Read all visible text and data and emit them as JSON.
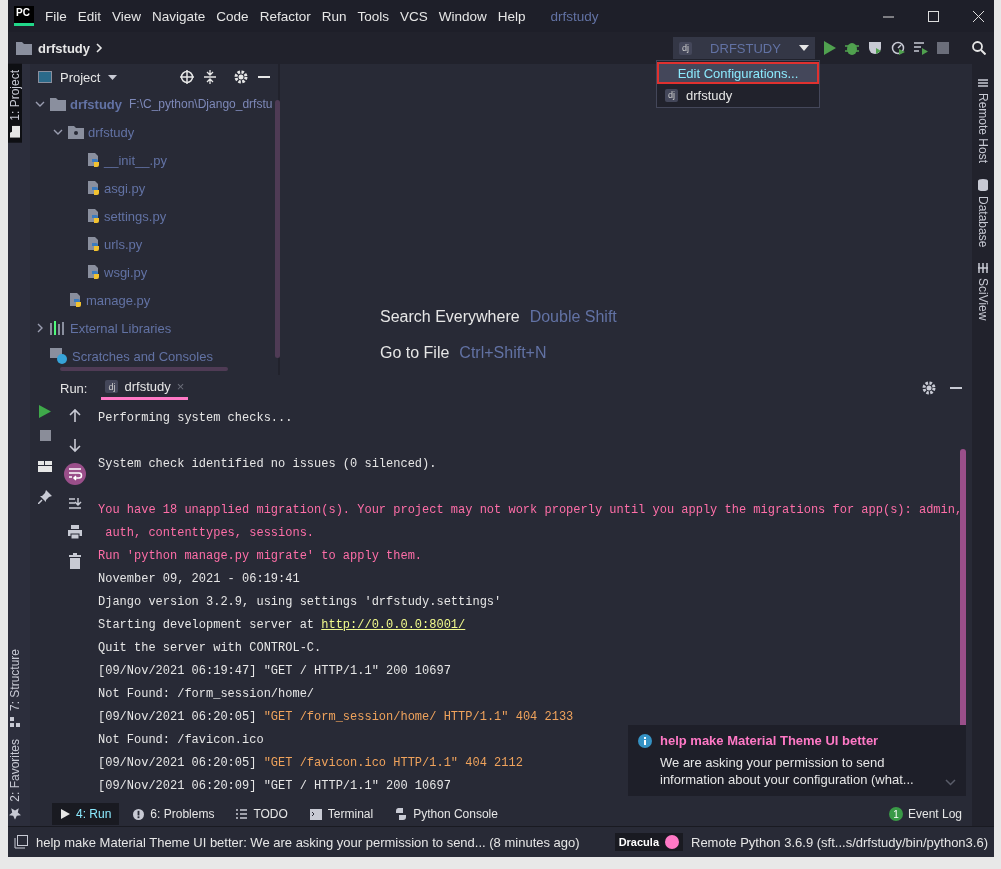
{
  "window": {
    "logo": "PC",
    "menu": [
      "File",
      "Edit",
      "View",
      "Navigate",
      "Code",
      "Refactor",
      "Run",
      "Tools",
      "VCS",
      "Window",
      "Help"
    ],
    "title": "drfstudy"
  },
  "navbar": {
    "breadcrumb": "drfstudy",
    "run_config": {
      "badge": "dj",
      "label": "DRFSTUDY"
    },
    "dropdown": [
      {
        "kind": "action",
        "label": "Edit Configurations...",
        "selected": true
      },
      {
        "kind": "config",
        "badge": "dj",
        "label": "drfstudy",
        "selected": false
      }
    ]
  },
  "left_stripe": {
    "top": [
      {
        "label": "1: Project",
        "selected": true
      }
    ],
    "bottom": [
      {
        "label": "7: Structure",
        "kind": "structure",
        "selected": false
      },
      {
        "label": "2: Favorites",
        "kind": "favorites",
        "selected": false
      }
    ]
  },
  "right_stripe": [
    {
      "label": "Remote Host",
      "kind": "remote"
    },
    {
      "label": "Database",
      "kind": "database"
    },
    {
      "label": "SciView",
      "kind": "sciview"
    }
  ],
  "project_panel": {
    "title": "Project",
    "tree": [
      {
        "kind": "root",
        "label": "drfstudy",
        "path": "F:\\C_python\\Django_drfstu",
        "expanded": true,
        "children": [
          {
            "kind": "package",
            "label": "drfstudy",
            "expanded": true,
            "children": [
              {
                "kind": "python",
                "label": "__init__.py"
              },
              {
                "kind": "python",
                "label": "asgi.py"
              },
              {
                "kind": "python",
                "label": "settings.py"
              },
              {
                "kind": "python",
                "label": "urls.py"
              },
              {
                "kind": "python",
                "label": "wsgi.py"
              }
            ]
          },
          {
            "kind": "python",
            "label": "manage.py"
          }
        ]
      },
      {
        "kind": "library",
        "label": "External Libraries",
        "expanded": false
      },
      {
        "kind": "scratches",
        "label": "Scratches and Consoles"
      }
    ]
  },
  "editor": {
    "hints": [
      {
        "action": "Search Everywhere",
        "shortcut": "Double Shift"
      },
      {
        "action": "Go to File",
        "shortcut": "Ctrl+Shift+N"
      }
    ]
  },
  "run_panel": {
    "label": "Run:",
    "tab": {
      "badge": "dj",
      "label": "drfstudy",
      "selected": true,
      "close": "×"
    },
    "tools": [
      {
        "kind": "up",
        "selected": false
      },
      {
        "kind": "down",
        "selected": false
      },
      {
        "kind": "wrap",
        "selected": true
      },
      {
        "kind": "scroll-end",
        "selected": false
      },
      {
        "kind": "print",
        "selected": false
      },
      {
        "kind": "trash",
        "selected": false
      }
    ],
    "console": [
      [
        {
          "kind": "plain",
          "text": "Performing system checks..."
        }
      ],
      [
        {
          "kind": "gap"
        },
        {
          "kind": "plain",
          "text": "System check identified no issues (0 silenced)."
        }
      ],
      [
        {
          "kind": "gap"
        },
        {
          "kind": "error",
          "text": "You have 18 unapplied migration(s). Your project may not work properly until you apply the migrations for app(s): admin,"
        }
      ],
      [
        {
          "kind": "error",
          "text": " auth, contenttypes, sessions."
        }
      ],
      [
        {
          "kind": "error",
          "text": "Run 'python manage.py migrate' to apply them."
        }
      ],
      [
        {
          "kind": "plain",
          "text": "November 09, 2021 - 06:19:41"
        }
      ],
      [
        {
          "kind": "plain",
          "text": "Django version 3.2.9, using settings 'drfstudy.settings'"
        }
      ],
      [
        {
          "kind": "plain",
          "text": "Starting development server at "
        },
        {
          "kind": "link",
          "text": "http://0.0.0.0:8001/"
        }
      ],
      [
        {
          "kind": "plain",
          "text": "Quit the server with CONTROL-C."
        }
      ],
      [
        {
          "kind": "plain",
          "text": "[09/Nov/2021 06:19:47] \"GET / HTTP/1.1\" 200 10697"
        }
      ],
      [
        {
          "kind": "plain",
          "text": "Not Found: /form_session/home/"
        }
      ],
      [
        {
          "kind": "plain",
          "text": "[09/Nov/2021 06:20:05] "
        },
        {
          "kind": "warning",
          "text": "\"GET /form_session/home/ HTTP/1.1\" 404 2133"
        }
      ],
      [
        {
          "kind": "plain",
          "text": "Not Found: /favicon.ico"
        }
      ],
      [
        {
          "kind": "plain",
          "text": "[09/Nov/2021 06:20:05] "
        },
        {
          "kind": "warning",
          "text": "\"GET /favicon.ico HTTP/1.1\" 404 2112"
        }
      ],
      [
        {
          "kind": "plain",
          "text": "[09/Nov/2021 06:20:09] \"GET / HTTP/1.1\" 200 10697"
        }
      ]
    ]
  },
  "notification": {
    "title": "help make Material Theme UI better",
    "body": "We are asking your permission to send information about your configuration (what..."
  },
  "bottom_tabs": [
    {
      "kind": "run",
      "label": "4: Run",
      "selected": true
    },
    {
      "kind": "problems",
      "label": "6: Problems",
      "selected": false
    },
    {
      "kind": "todo",
      "label": "TODO",
      "selected": false
    },
    {
      "kind": "terminal",
      "label": "Terminal",
      "selected": false
    },
    {
      "kind": "python",
      "label": "Python Console",
      "selected": false
    }
  ],
  "event_log": {
    "count": "1",
    "label": "Event Log"
  },
  "status_bar": {
    "message": "help make Material Theme UI better: We are asking your permission to send... (8 minutes ago)",
    "theme": "Dracula",
    "interpreter": "Remote Python 3.6.9 (sft...s/drfstudy/bin/python3.6)"
  }
}
